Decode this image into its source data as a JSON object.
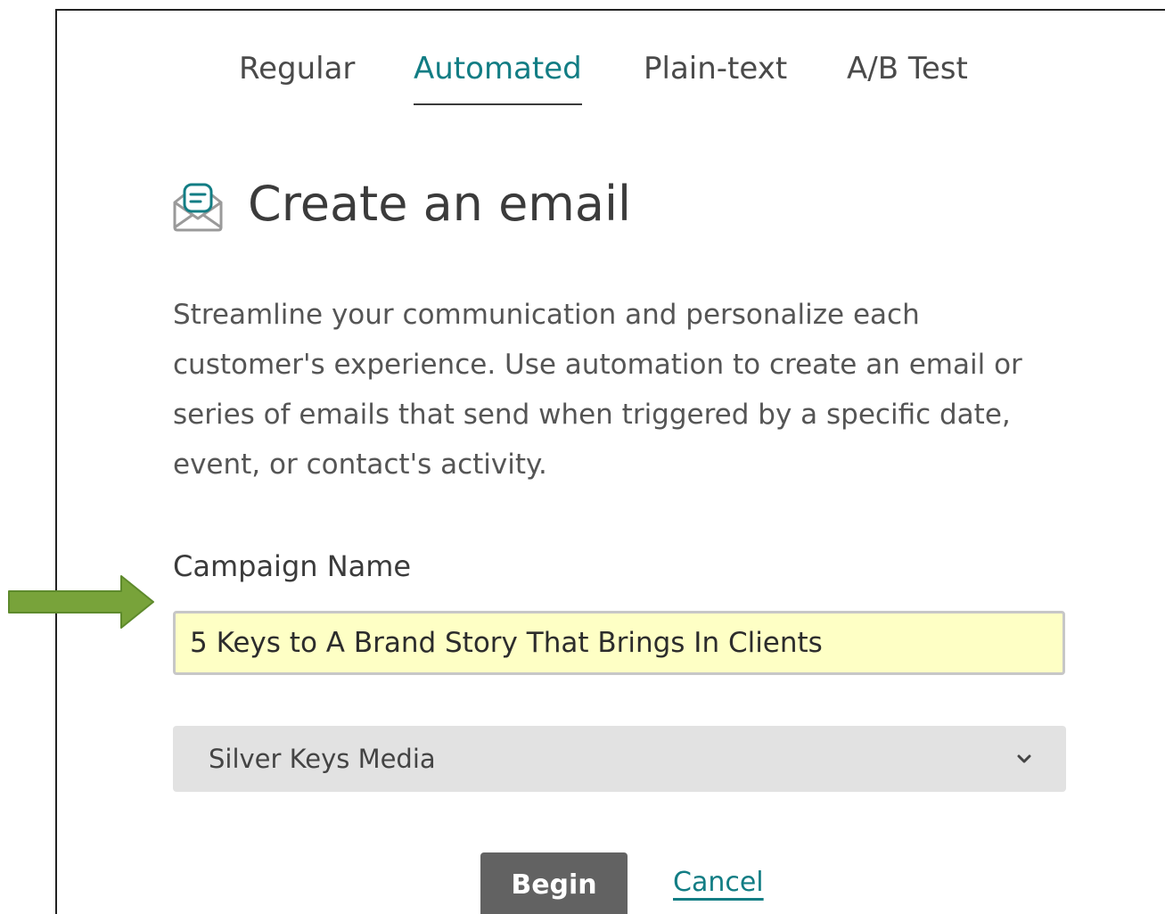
{
  "tabs": [
    {
      "label": "Regular",
      "active": false
    },
    {
      "label": "Automated",
      "active": true
    },
    {
      "label": "Plain-text",
      "active": false
    },
    {
      "label": "A/B Test",
      "active": false
    }
  ],
  "header": {
    "title": "Create an email",
    "icon": "email-icon"
  },
  "description": "Streamline your communication and personalize each customer's experience. Use automation to create an email or series of emails that send when triggered by a specific date, event, or contact's activity.",
  "campaign_name": {
    "label": "Campaign Name",
    "value": "5 Keys to A Brand Story That Brings In Clients"
  },
  "audience_select": {
    "value": "Silver Keys Media"
  },
  "actions": {
    "begin_label": "Begin",
    "cancel_label": "Cancel"
  },
  "colors": {
    "accent": "#127d84",
    "input_highlight": "#feffc5",
    "arrow": "#78a33a",
    "button": "#626262"
  }
}
